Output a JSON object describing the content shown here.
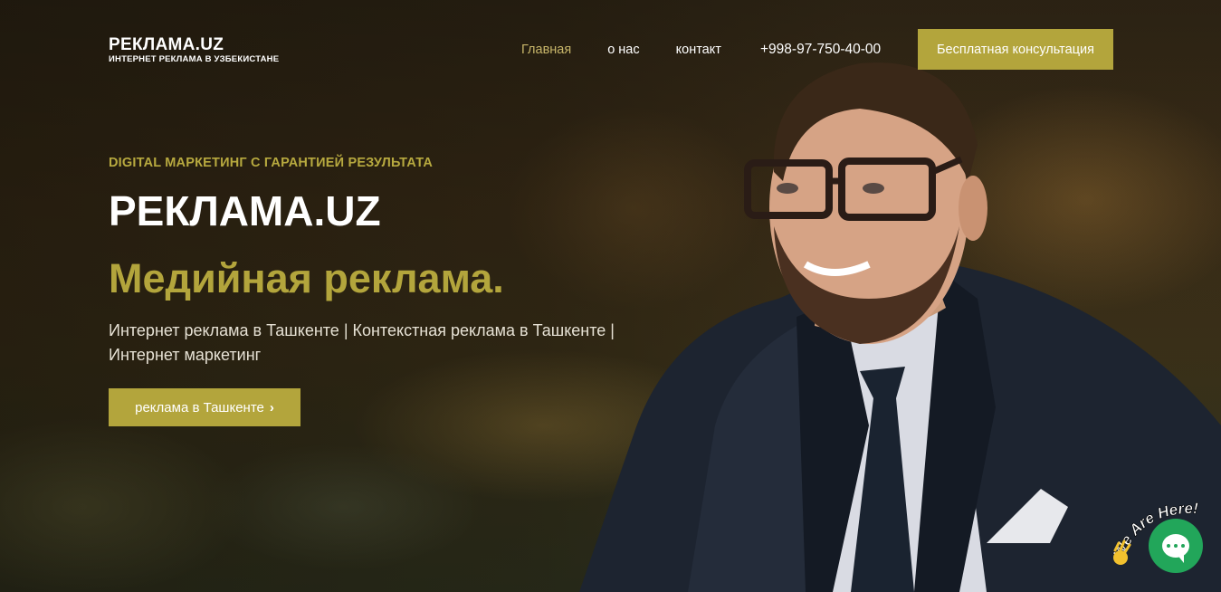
{
  "header": {
    "logo_title": "РЕКЛАМА.UZ",
    "logo_subtitle": "ИНТЕРНЕТ РЕКЛАМА В УЗБЕКИСТАНЕ",
    "nav": {
      "home": "Главная",
      "about": "о нас",
      "contact": "контакт",
      "phone": "+998-97-750-40-00"
    },
    "cta": "Бесплатная консультация"
  },
  "hero": {
    "eyebrow": "DIGITAL МАРКЕТИНГ С ГАРАНТИЕЙ РЕЗУЛЬТАТА",
    "title": "РЕКЛАМА.UZ",
    "subtitle": "Медийная реклама.",
    "description": "Интернет реклама в Ташкенте | Контекстная реклама в Ташкенте | Интернет маркетинг",
    "button": "реклама в Ташкенте",
    "button_icon": "chevron-right-icon"
  },
  "chat_widget": {
    "badge_text": "We Are Here!",
    "icon": "chat-bubble-icon",
    "wave_icon": "waving-hand-icon"
  },
  "colors": {
    "accent": "#b3a53c",
    "active_nav": "#c8b66a",
    "chat": "#22a65a"
  }
}
